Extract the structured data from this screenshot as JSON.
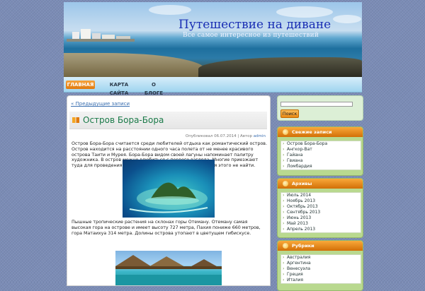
{
  "header": {
    "title": "Путешествие на диване",
    "description": "Все самое интересное из путешествий"
  },
  "nav": {
    "items": [
      {
        "label": "ГЛАВНАЯ",
        "active": true
      },
      {
        "label": "КАРТА САЙТА",
        "active": false
      },
      {
        "label": "О БЛОГЕ",
        "active": false
      }
    ]
  },
  "main": {
    "prev_link": "« Предыдущие записи",
    "post": {
      "title": "Остров Бора-Бора",
      "meta_prefix": "Опубликовал 06.07.2014 | Автор ",
      "author": "admin",
      "paragraph1": "Остров Бора-Бора  считается среди любителей отдыха как романтический остров. Остров находится на расстоянии одного часа полета от не менее красивого острова Таити и Мурея. Бора-Бора видом своей лагуны напоминает палитру художника. В остров можно влюбиться с первого взгляда. Многие приезжают туда для проведения медового месяца, и лучшего места для этого не найти.",
      "paragraph2": "Пышные тропические растения на склонах горы Отеману. Отеману самая высокая гора на острове и имеет высоту 727 метра, Пахия пониже 660 метров, гора Матаихуа 314 метра. Долины острова утопают в цветущем гибискусе."
    }
  },
  "sidebar": {
    "search_button": "Поиск",
    "recent": {
      "title": "Свежие записи",
      "items": [
        "Остров Бора-Бора",
        "Ангкор-Ват",
        "Гайана",
        "Гвиана",
        "Ломбардия"
      ]
    },
    "archives": {
      "title": "Архивы",
      "items": [
        "Июль 2014",
        "Ноябрь 2013",
        "Октябрь 2013",
        "Сентябрь 2013",
        "Июнь 2013",
        "Май 2013",
        "Апрель 2013"
      ]
    },
    "categories": {
      "title": "Рубрики",
      "items": [
        "Австралия",
        "Аргентина",
        "Венесуэла",
        "Греция",
        "Италия"
      ]
    }
  },
  "colors": {
    "accent_orange": "#e98a14",
    "title_green": "#1a7a48",
    "site_title_blue": "#1a2fb4",
    "background": "#7b8cb6"
  }
}
